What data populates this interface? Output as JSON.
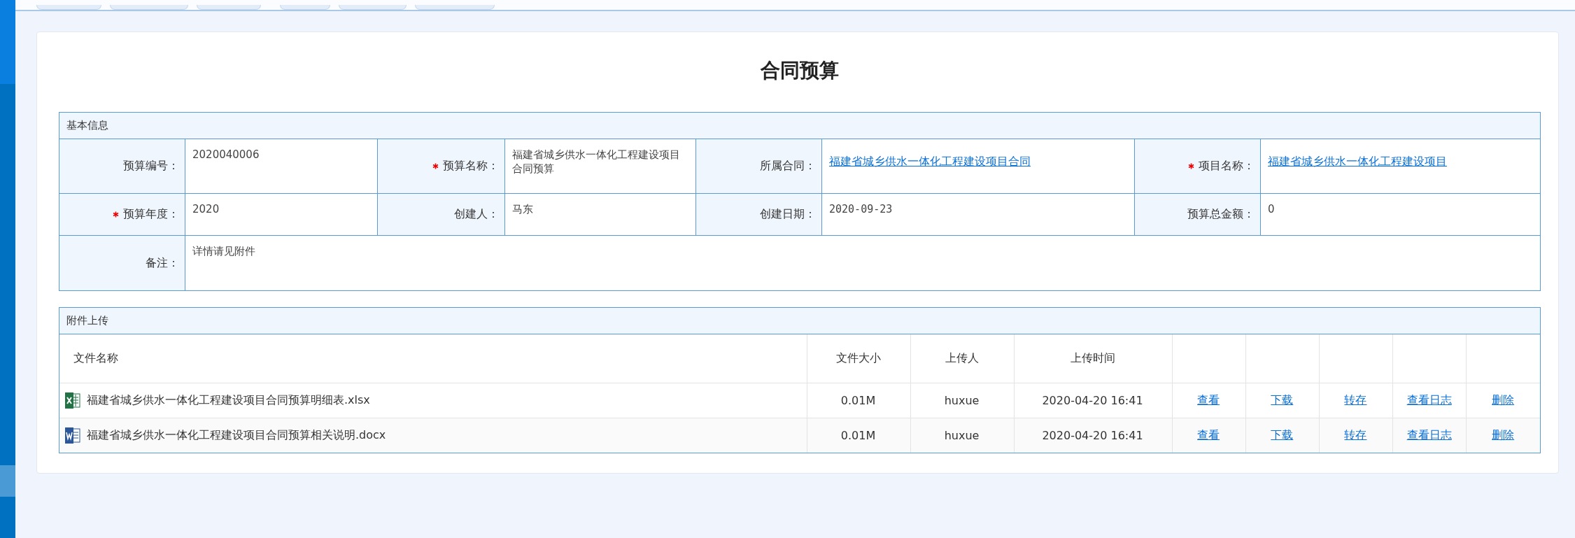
{
  "title": "合同预算",
  "basic_info": {
    "heading": "基本信息",
    "rows": [
      [
        {
          "label": "预算编号：",
          "required": false,
          "value": "2020040006",
          "kind": "text"
        },
        {
          "label": "预算名称：",
          "required": true,
          "value": "福建省城乡供水一体化工程建设项目合同预算",
          "kind": "text"
        },
        {
          "label": "所属合同：",
          "required": false,
          "value": "福建省城乡供水一体化工程建设项目合同",
          "kind": "link"
        },
        {
          "label": "项目名称：",
          "required": true,
          "value": "福建省城乡供水一体化工程建设项目",
          "kind": "link"
        }
      ],
      [
        {
          "label": "预算年度：",
          "required": true,
          "value": "2020",
          "kind": "text"
        },
        {
          "label": "创建人：",
          "required": false,
          "value": "马东",
          "kind": "text"
        },
        {
          "label": "创建日期：",
          "required": false,
          "value": "2020-09-23",
          "kind": "text"
        },
        {
          "label": "预算总金额：",
          "required": false,
          "value": "0",
          "kind": "text"
        }
      ]
    ],
    "remark": {
      "label": "备注：",
      "value": "详情请见附件"
    }
  },
  "attachments": {
    "heading": "附件上传",
    "columns": [
      "文件名称",
      "文件大小",
      "上传人",
      "上传时间"
    ],
    "rows": [
      {
        "kind": "excel",
        "name": "福建省城乡供水一体化工程建设项目合同预算明细表.xlsx",
        "size": "0.01M",
        "uploader": "huxue",
        "time": "2020-04-20 16:41",
        "actions": [
          "查看",
          "下载",
          "转存",
          "查看日志",
          "删除"
        ]
      },
      {
        "kind": "word",
        "name": "福建省城乡供水一体化工程建设项目合同预算相关说明.docx",
        "size": "0.01M",
        "uploader": "huxue",
        "time": "2020-04-20 16:41",
        "actions": [
          "查看",
          "下载",
          "转存",
          "查看日志",
          "删除"
        ]
      }
    ]
  }
}
